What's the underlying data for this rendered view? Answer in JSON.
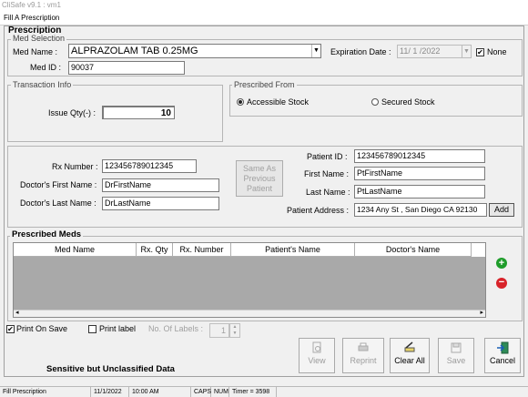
{
  "app_title": "CliSafe v9.1 : vm1",
  "window_title": "Fill A Prescription",
  "section_title": "Prescription",
  "med_selection": {
    "legend": "Med Selection",
    "med_name_label": "Med Name :",
    "med_name_value": "ALPRAZOLAM TAB 0.25MG",
    "med_id_label": "Med ID :",
    "med_id_value": "90037",
    "expiration_label": "Expiration Date :",
    "expiration_value": "11/ 1 /2022",
    "none_label": "None",
    "none_checked": true
  },
  "transaction": {
    "legend": "Transaction Info",
    "issue_qty_label": "Issue Qty(-) :",
    "issue_qty_value": "10"
  },
  "prescribed_from": {
    "legend": "Prescribed From",
    "options": [
      "Accessible Stock",
      "Secured Stock"
    ],
    "selected": "Accessible Stock"
  },
  "doctor": {
    "rx_number_label": "Rx Number :",
    "rx_number_value": "123456789012345",
    "first_name_label": "Doctor's First Name :",
    "first_name_value": "DrFirstName",
    "last_name_label": "Doctor's Last Name :",
    "last_name_value": "DrLastName",
    "same_as_patient_label": "Same As Previous Patient"
  },
  "patient": {
    "id_label": "Patient ID :",
    "id_value": "123456789012345",
    "first_name_label": "First Name :",
    "first_name_value": "PtFirstName",
    "last_name_label": "Last Name :",
    "last_name_value": "PtLastName",
    "address_label": "Patient Address :",
    "address_value": "1234 Any St , San Diego CA 92130",
    "add_button": "Add"
  },
  "prescribed_meds": {
    "legend": "Prescribed Meds",
    "columns": [
      "Med Name",
      "Rx. Qty",
      "Rx. Number",
      "Patient's Name",
      "Doctor's Name"
    ]
  },
  "options": {
    "print_on_save_label": "Print On Save",
    "print_on_save_checked": true,
    "print_label_label": "Print label",
    "print_label_checked": false,
    "no_of_labels_label": "No. Of Labels :",
    "no_of_labels_value": "1"
  },
  "footer_note": "Sensitive but Unclassified  Data",
  "toolbar": {
    "view": "View",
    "reprint": "Reprint",
    "clear_all": "Clear All",
    "save": "Save",
    "cancel": "Cancel"
  },
  "status_bar": {
    "window": "Fill Prescription",
    "date": "11/1/2022",
    "time": "10:00 AM",
    "caps": "CAPS",
    "num": "NUM",
    "timer": "Timer = 3598"
  },
  "colors": {
    "add_icon": "#1f9d2b",
    "remove_icon": "#d8232a",
    "grid_body": "#a9a9a9"
  }
}
